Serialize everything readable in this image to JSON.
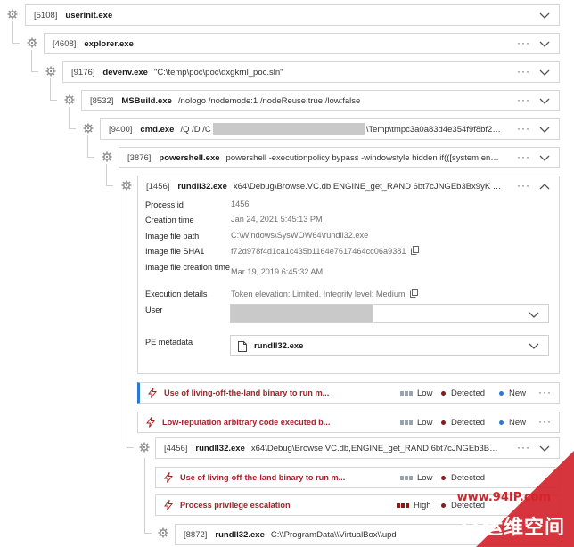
{
  "colors": {
    "accent": "#2b79d6",
    "alert_text": "#a3222a",
    "detected_dot": "#8b1a1a",
    "new_dot": "#2b79d6",
    "watermark": "#d3242c"
  },
  "tree": [
    {
      "pid": "[5108]",
      "name": "userinit.exe",
      "cmd": ""
    },
    {
      "pid": "[4608]",
      "name": "explorer.exe",
      "cmd": ""
    },
    {
      "pid": "[9176]",
      "name": "devenv.exe",
      "cmd": "\"C:\\temp\\poc\\poc\\dxgkrnl_poc.sln\""
    },
    {
      "pid": "[8532]",
      "name": "MSBuild.exe",
      "cmd": "/nologo /nodemode:1 /nodeReuse:true /low:false"
    },
    {
      "pid": "[9400]",
      "name": "cmd.exe",
      "cmd": "/Q /D /C",
      "cmd_tail": "\\Temp\\tmpc3a0a83d4e354f9f8bf28f18efd1ad..."
    },
    {
      "pid": "[3876]",
      "name": "powershell.exe",
      "cmd": "powershell -executionpolicy bypass -windowstyle hidden if(([system.envir..."
    },
    {
      "pid": "[1456]",
      "name": "rundll32.exe",
      "cmd": "x64\\Debug\\Browse.VC.db,ENGINE_get_RAND 6bt7cJNGEb3Bx9yK 2907"
    }
  ],
  "details": {
    "process_id": {
      "label": "Process id",
      "value": "1456"
    },
    "creation_time": {
      "label": "Creation time",
      "value": "Jan 24, 2021 5:45:13 PM"
    },
    "image_path": {
      "label": "Image file path",
      "value": "C:\\Windows\\SysWOW64\\rundll32.exe"
    },
    "image_sha1": {
      "label": "Image file SHA1",
      "value": "f72d978f4d1ca1c435b1164e7617464cc06a9381"
    },
    "image_ctime": {
      "label": "Image file creation time",
      "value": "Mar 19, 2019 6:45:32 AM"
    },
    "exec_details": {
      "label": "Execution details",
      "value": "Token elevation: Limited. Integrity level: Medium"
    },
    "user": {
      "label": "User"
    },
    "pe_metadata": {
      "label": "PE metadata",
      "value": "rundll32.exe"
    }
  },
  "alerts": [
    {
      "title": "Use of living-off-the-land binary to run m...",
      "severity": "Low",
      "status": "Detected",
      "state": "New"
    },
    {
      "title": "Low-reputation arbitrary code executed b...",
      "severity": "Low",
      "status": "Detected",
      "state": "New"
    }
  ],
  "child": {
    "pid": "[4456]",
    "name": "rundll32.exe",
    "cmd": "x64\\Debug\\Browse.VC.db,ENGINE_get_RAND 6bt7cJNGEb3Bx9yK ..."
  },
  "child_alerts": [
    {
      "title": "Use of living-off-the-land binary to run m...",
      "severity": "Low",
      "status": "Detected"
    },
    {
      "title": "Process privilege escalation",
      "severity": "High",
      "status": "Detected"
    }
  ],
  "grandchild": {
    "pid": "[8872]",
    "name": "rundll32.exe",
    "cmd": "C:\\\\ProgramData\\\\VirtualBox\\\\upd"
  },
  "watermark": {
    "url": "www.94IP.com",
    "text": "IT运维空间"
  }
}
